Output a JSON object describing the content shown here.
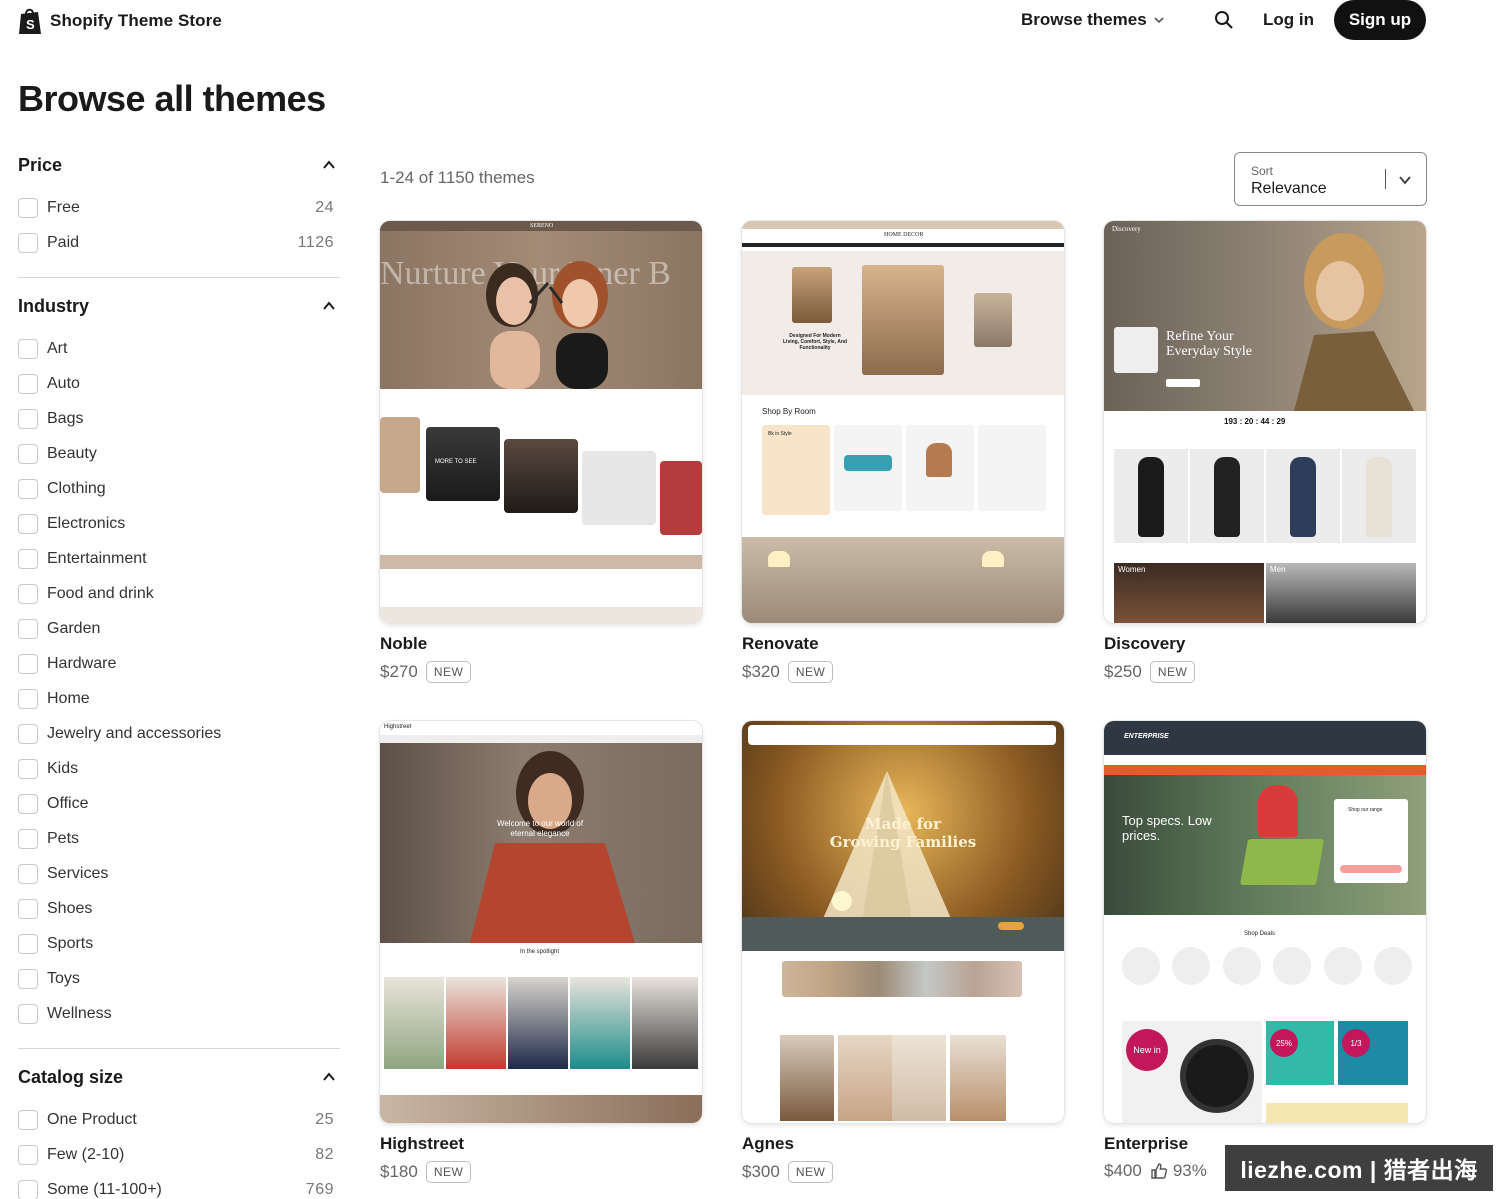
{
  "header": {
    "logo_text": "Shopify Theme Store",
    "browse_label": "Browse themes",
    "login_label": "Log in",
    "signup_label": "Sign up"
  },
  "page_title": "Browse all themes",
  "filters": {
    "price": {
      "title": "Price",
      "options": [
        {
          "label": "Free",
          "count": "24"
        },
        {
          "label": "Paid",
          "count": "1126"
        }
      ]
    },
    "industry": {
      "title": "Industry",
      "options": [
        {
          "label": "Art"
        },
        {
          "label": "Auto"
        },
        {
          "label": "Bags"
        },
        {
          "label": "Beauty"
        },
        {
          "label": "Clothing"
        },
        {
          "label": "Electronics"
        },
        {
          "label": "Entertainment"
        },
        {
          "label": "Food and drink"
        },
        {
          "label": "Garden"
        },
        {
          "label": "Hardware"
        },
        {
          "label": "Home"
        },
        {
          "label": "Jewelry and accessories"
        },
        {
          "label": "Kids"
        },
        {
          "label": "Office"
        },
        {
          "label": "Pets"
        },
        {
          "label": "Services"
        },
        {
          "label": "Shoes"
        },
        {
          "label": "Sports"
        },
        {
          "label": "Toys"
        },
        {
          "label": "Wellness"
        }
      ]
    },
    "catalog": {
      "title": "Catalog size",
      "options": [
        {
          "label": "One Product",
          "count": "25"
        },
        {
          "label": "Few (2-10)",
          "count": "82"
        },
        {
          "label": "Some (11-100+)",
          "count": "769"
        }
      ]
    }
  },
  "results": {
    "count_text": "1-24 of 1150 themes",
    "sort_label": "Sort",
    "sort_value": "Relevance"
  },
  "themes": [
    {
      "name": "Noble",
      "price": "$270",
      "badge": "NEW",
      "preview": {
        "brand": "SERENO",
        "hero_text": "Nurture Your Inner B",
        "button": "MORE TO SEE"
      }
    },
    {
      "name": "Renovate",
      "price": "$320",
      "badge": "NEW",
      "preview": {
        "brand": "HOME DECOR",
        "hero_text": "Designed For Modern Living, Comfort, Style, And Functionality",
        "section": "Shop By Room",
        "card": "Bk in Style"
      }
    },
    {
      "name": "Discovery",
      "price": "$250",
      "badge": "NEW",
      "preview": {
        "brand": "Discovery",
        "hero_text": "Refine Your Everyday Style",
        "timer": "193 : 20 : 44 : 29",
        "tile_left": "Women",
        "tile_right": "Men"
      }
    },
    {
      "name": "Highstreet",
      "price": "$180",
      "badge": "NEW",
      "preview": {
        "brand": "Highstreet",
        "hero_text": "Welcome to our world of eternal elegance",
        "section": "In the spotlight"
      }
    },
    {
      "name": "Agnes",
      "price": "$300",
      "badge": "NEW",
      "preview": {
        "hero_text": "Made for Growing Families"
      }
    },
    {
      "name": "Enterprise",
      "price": "$400",
      "rating": "93%",
      "preview": {
        "brand": "ENTERPRISE",
        "hero_text": "Top specs. Low prices.",
        "section": "Shop Deals",
        "panel": "Shop our range",
        "badge_new": "New in",
        "promo": "25%",
        "promo2": "1/3"
      }
    }
  ],
  "watermark": "liezhe.com | 猎者出海",
  "colors": {
    "primary_button": "#111111",
    "border": "#c9c9c9",
    "muted_text": "#666666"
  }
}
